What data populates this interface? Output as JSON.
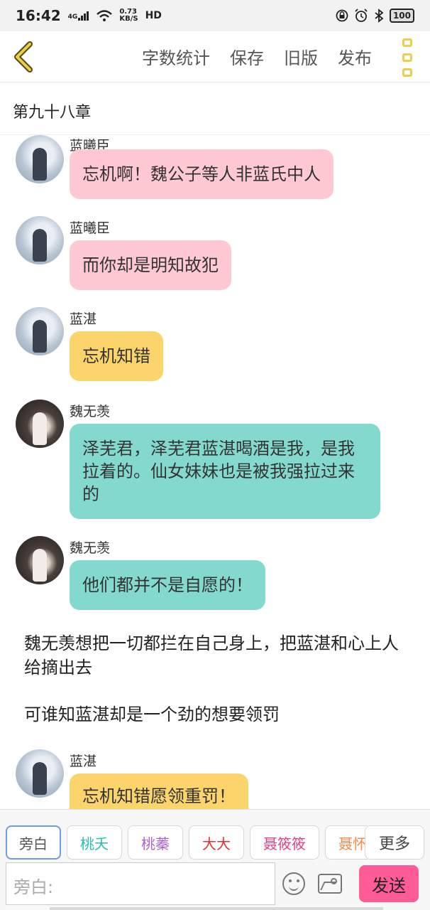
{
  "status_bar": {
    "time": "16:42",
    "network_type": "4G",
    "speed_value": "0.73",
    "speed_unit": "KB/S",
    "hd": "HD",
    "battery": "100"
  },
  "toolbar": {
    "word_count": "字数统计",
    "save": "保存",
    "old_version": "旧版",
    "publish": "发布"
  },
  "chapter_title": "第九十八章",
  "messages": [
    {
      "speaker": "蓝曦臣",
      "text": "忘机啊！魏公子等人非蓝氏中人"
    },
    {
      "speaker": "蓝曦臣",
      "text": "而你却是明知故犯"
    },
    {
      "speaker": "蓝湛",
      "text": "忘机知错"
    },
    {
      "speaker": "魏无羡",
      "text": "泽芜君，泽芜君蓝湛喝酒是我，是我拉着的。仙女妹妹也是被我强拉过来的"
    },
    {
      "speaker": "魏无羡",
      "text": "他们都并不是自愿的！"
    },
    {
      "speaker": "蓝湛",
      "text": "忘机知错愿领重罚！"
    }
  ],
  "narration": [
    "魏无羡想把一切都拦在自己身上，把蓝湛和心上人给摘出去",
    "可谁知蓝湛却是一个劲的想要领罚"
  ],
  "roles": [
    {
      "label": "旁白",
      "color": "#555555"
    },
    {
      "label": "桃夭",
      "color": "#2bbfae"
    },
    {
      "label": "桃蓁",
      "color": "#b060d6"
    },
    {
      "label": "大大",
      "color": "#e03030"
    },
    {
      "label": "聂筱筱",
      "color": "#e0408a"
    },
    {
      "label": "聂怀",
      "color": "#f08a4b"
    }
  ],
  "more_label": "更多",
  "input_placeholder": "旁白:",
  "send_label": "发送",
  "colors": {
    "pink_bubble": "#ffc9d3",
    "yellow_bubble": "#fbd56b",
    "teal_bubble": "#84d9cf",
    "send_button": "#ff5b94",
    "accent_yellow": "#e9cf4f"
  }
}
